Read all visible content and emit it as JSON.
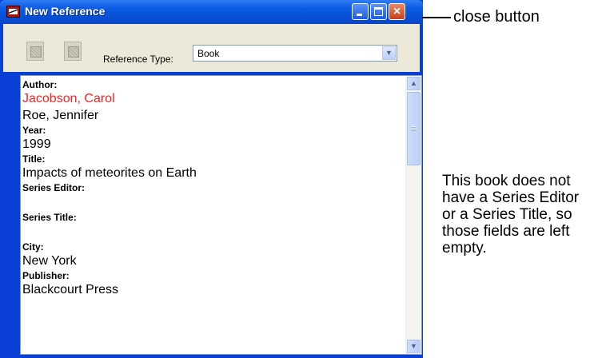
{
  "window": {
    "title": "New Reference",
    "buttons": {
      "minimize": "minimize",
      "maximize": "maximize",
      "close": "×"
    }
  },
  "toolbar": {
    "reference_type_label": "Reference Type:",
    "reference_type_value": "Book"
  },
  "fields": [
    {
      "label": "Author:",
      "values": [
        "Jacobson, Carol",
        "Roe, Jennifer"
      ]
    },
    {
      "label": "Year:",
      "values": [
        "1999"
      ]
    },
    {
      "label": "Title:",
      "values": [
        "Impacts of meteorites on Earth"
      ]
    },
    {
      "label": "Series Editor:",
      "values": []
    },
    {
      "label": "Series Title:",
      "values": []
    },
    {
      "label": "City:",
      "values": [
        "New York"
      ]
    },
    {
      "label": "Publisher:",
      "values": [
        "Blackcourt Press"
      ]
    }
  ],
  "annotations": {
    "close_button_callout": "close button",
    "note": "This book does not have a Series Editor or a Series Title, so those fields are left empty."
  },
  "colors": {
    "title_bar": "#0b5be2",
    "highlight_author": "#ff2020"
  }
}
